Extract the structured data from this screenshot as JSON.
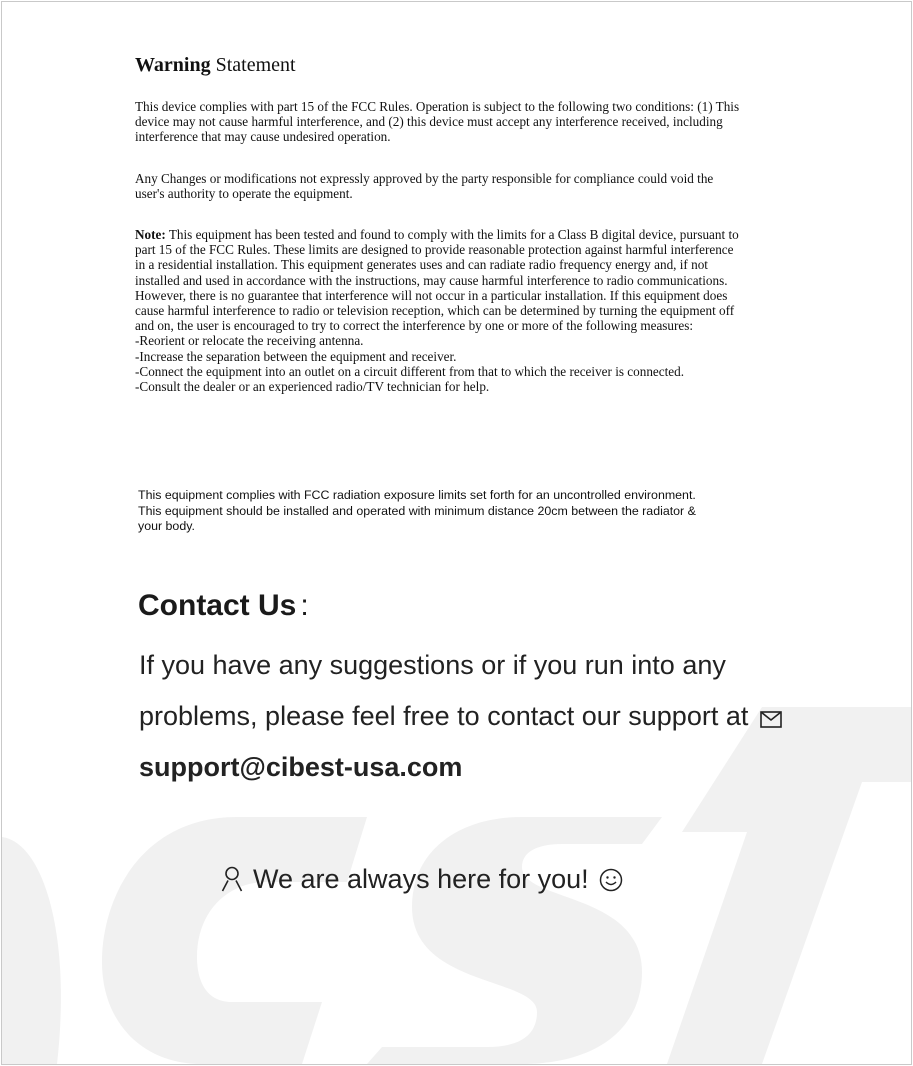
{
  "warning": {
    "title_bold": "Warning",
    "title_rest": "Statement",
    "paragraph1": "This device complies with part 15 of the FCC Rules. Operation is subject to the following two conditions: (1) This device may not cause harmful interference, and (2) this device must accept any interference received, including interference that may cause undesired operation.",
    "paragraph2": "Any Changes or modifications not expressly approved by the party responsible for compliance could void the user's authority to operate the equipment.",
    "note_label": "Note:",
    "note_text": "This equipment has been tested and found to comply with the limits for a Class B digital device, pursuant to part 15 of the FCC Rules. These limits are designed to provide reasonable protection against harmful interference in a residential installation. This equipment generates uses and can radiate radio frequency energy and, if not installed and used in accordance with the instructions, may cause harmful interference to radio communications. However, there is no guarantee that interference will not occur in a particular installation. If this equipment does cause harmful interference to radio or television reception, which can be determined by turning the equipment off and on, the user is encouraged to try to correct the interference by one or more of the following measures:",
    "measures": [
      "-Reorient or relocate the receiving antenna.",
      "-Increase the separation between the equipment and receiver.",
      "-Connect the equipment into an outlet on a circuit different from that to which the receiver is connected.",
      "-Consult the dealer or an experienced radio/TV technician for help."
    ],
    "radiation_text": "This equipment complies with FCC radiation exposure limits set forth for an uncontrolled environment. This equipment should be installed and operated with minimum distance 20cm between the radiator & your body."
  },
  "contact": {
    "title": "Contact Us",
    "colon": ":",
    "text": "If you have any suggestions or if you run into any problems, please feel free to contact our support at",
    "email": "support@cibest-usa.com",
    "tagline": "We are always here for you!"
  },
  "icons": {
    "mail": "mail-icon",
    "person": "person-icon",
    "smile": "smile-icon"
  },
  "colors": {
    "watermark": "#f1f1f1",
    "text": "#111111"
  }
}
